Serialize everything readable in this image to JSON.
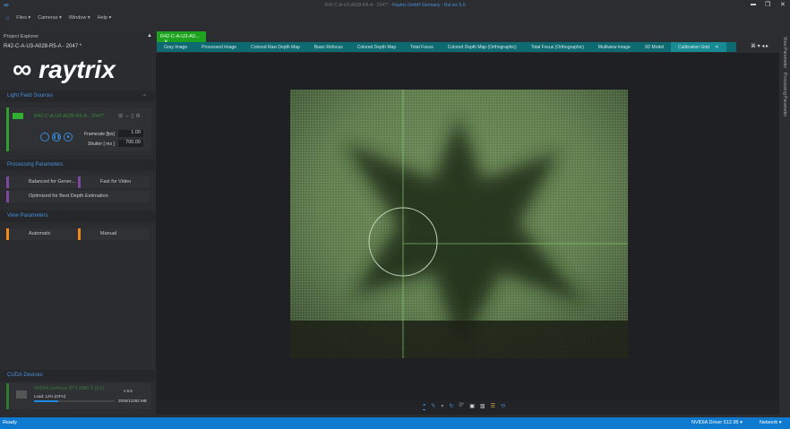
{
  "window": {
    "title_prefix": "R42-C-A-U3-A028-R5-A - 2047* - ",
    "title_suffix": "Raytrix GmbH Germany - RxLive 5.0",
    "buttons": [
      "minimize",
      "restore",
      "close"
    ]
  },
  "menu": {
    "items": [
      "Files ▾",
      "Cameras ▾",
      "Window ▾",
      "Help ▾"
    ]
  },
  "explorer": {
    "title": "Project Explorer",
    "project": "R42-C-A-U3-A028-R5-A - 2047 *",
    "logo": "raytrix"
  },
  "light_field": {
    "title": "Light Field Sources",
    "camera": "R42-C-A-U3-A028-R5-A - 2047*",
    "framerate_label": "Framerate [fps]",
    "framerate": "1.00",
    "shutter_label": "Shutter [ ms ]",
    "shutter": "700.00"
  },
  "processing": {
    "title": "Processing Parameters",
    "presets": [
      "Balanced for Gener...",
      "Fast for Video",
      "Optimized for Best Depth Estimation"
    ]
  },
  "view": {
    "title": "View Parameters",
    "presets": [
      "Automatic",
      "Manual"
    ]
  },
  "cuda": {
    "title": "CUDA Devices",
    "device": "NVIDIA GeForce RTX 3080 Ti (0:0)",
    "load": "Load: 12%",
    "clock": "(GPU)",
    "cc": "v 8.6",
    "memory": "2006/12282 MB",
    "load_fraction": 0.12
  },
  "document_tab": "R42-C-A-U3-A0...",
  "view_tabs": [
    "Gray Image",
    "Processed Image",
    "Colored Raw Depth Map",
    "Basic Refocus",
    "Colored Depth Map",
    "Total Focus",
    "Colored Depth Map (Orthographic)",
    "Total Focus (Orthographic)",
    "Multiview Image",
    "3D Model",
    "Calibration Grid"
  ],
  "active_tab": "Calibration Grid",
  "toolbar": {
    "rotation": "0°"
  },
  "right_strip": [
    "View Parameter",
    "Processing Parameter"
  ],
  "status": {
    "text": "Ready",
    "driver": "NVIDIA Driver 512.95 ▾",
    "network": "Network ▾"
  }
}
